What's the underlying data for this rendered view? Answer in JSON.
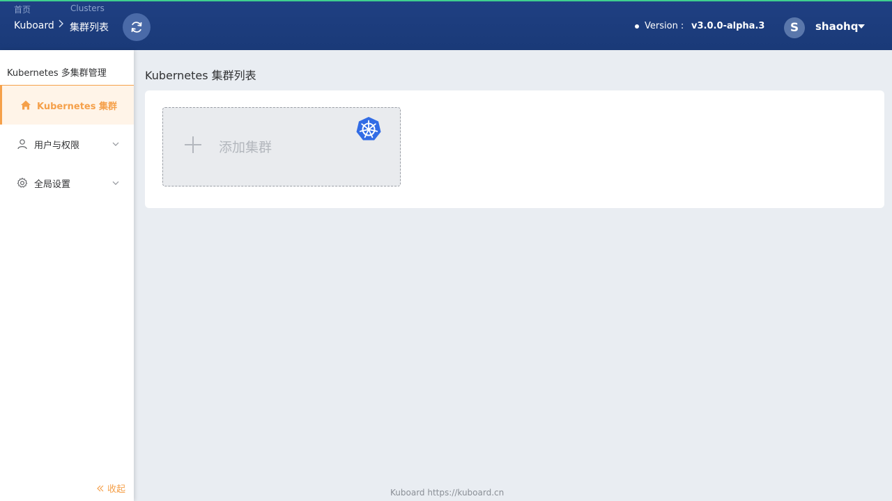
{
  "topbar": {
    "nav_home": "首页",
    "nav_clusters": "Clusters",
    "breadcrumb_root": "Kuboard",
    "breadcrumb_separator": ">",
    "breadcrumb_current": "集群列表",
    "version_label": "Version :",
    "version_value": "v3.0.0-alpha.3",
    "user_initial": "S",
    "username": "shaohq",
    "refresh_icon": "refresh-icon",
    "accent_color": "#3ecf8e"
  },
  "sidebar": {
    "title": "Kubernetes 多集群管理",
    "items": [
      {
        "label": "Kubernetes 集群",
        "icon": "home-icon",
        "active": true
      },
      {
        "label": "用户与权限",
        "icon": "user-icon",
        "active": false
      },
      {
        "label": "全局设置",
        "icon": "gear-icon",
        "active": false
      }
    ],
    "collapse_label": "收起",
    "accent_color": "#f5a04a"
  },
  "main": {
    "title": "Kubernetes 集群列表",
    "add_cluster_label": "添加集群",
    "k8s_logo": "kubernetes-logo-icon"
  },
  "footer": {
    "text": "Kuboard https://kuboard.cn"
  }
}
